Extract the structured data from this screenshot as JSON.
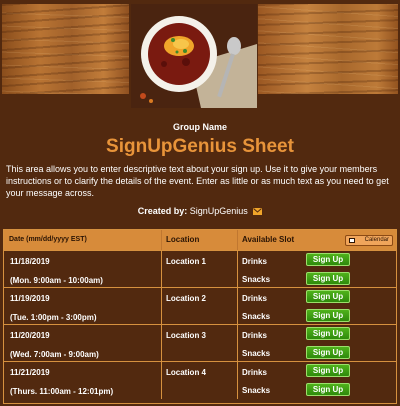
{
  "header": {
    "group_name": "Group Name",
    "title": "SignUpGenius Sheet"
  },
  "description": "This area allows you to enter descriptive text about your sign up. Use it to give your members instructions or to clarify the details of the event. Enter as little or as much text as you need to get your message across.",
  "created_by": {
    "label": "Created by:",
    "name": "SignUpGenius",
    "icon": "mail-icon"
  },
  "table": {
    "headers": {
      "date": "Date (mm/dd/yyyy EST)",
      "location": "Location",
      "slot": "Available Slot",
      "calendar": "Calendar"
    },
    "rows": [
      {
        "date": "11/18/2019",
        "time": "(Mon. 9:00am - 10:00am)",
        "location": "Location 1",
        "items": [
          "Drinks",
          "Snacks"
        ],
        "button": "Sign Up"
      },
      {
        "date": "11/19/2019",
        "time": "(Tue. 1:00pm - 3:00pm)",
        "location": "Location 2",
        "items": [
          "Drinks",
          "Snacks"
        ],
        "button": "Sign Up"
      },
      {
        "date": "11/20/2019",
        "time": "(Wed. 7:00am - 9:00am)",
        "location": "Location 3",
        "items": [
          "Drinks",
          "Snacks"
        ],
        "button": "Sign Up"
      },
      {
        "date": "11/21/2019",
        "time": "(Thurs. 11:00am - 12:01pm)",
        "location": "Location 4",
        "items": [
          "Drinks",
          "Snacks"
        ],
        "button": "Sign Up"
      }
    ]
  },
  "colors": {
    "background": "#52290f",
    "title": "#e8943a",
    "header_bar": "#d78b3a",
    "button": "#3d9c12"
  }
}
